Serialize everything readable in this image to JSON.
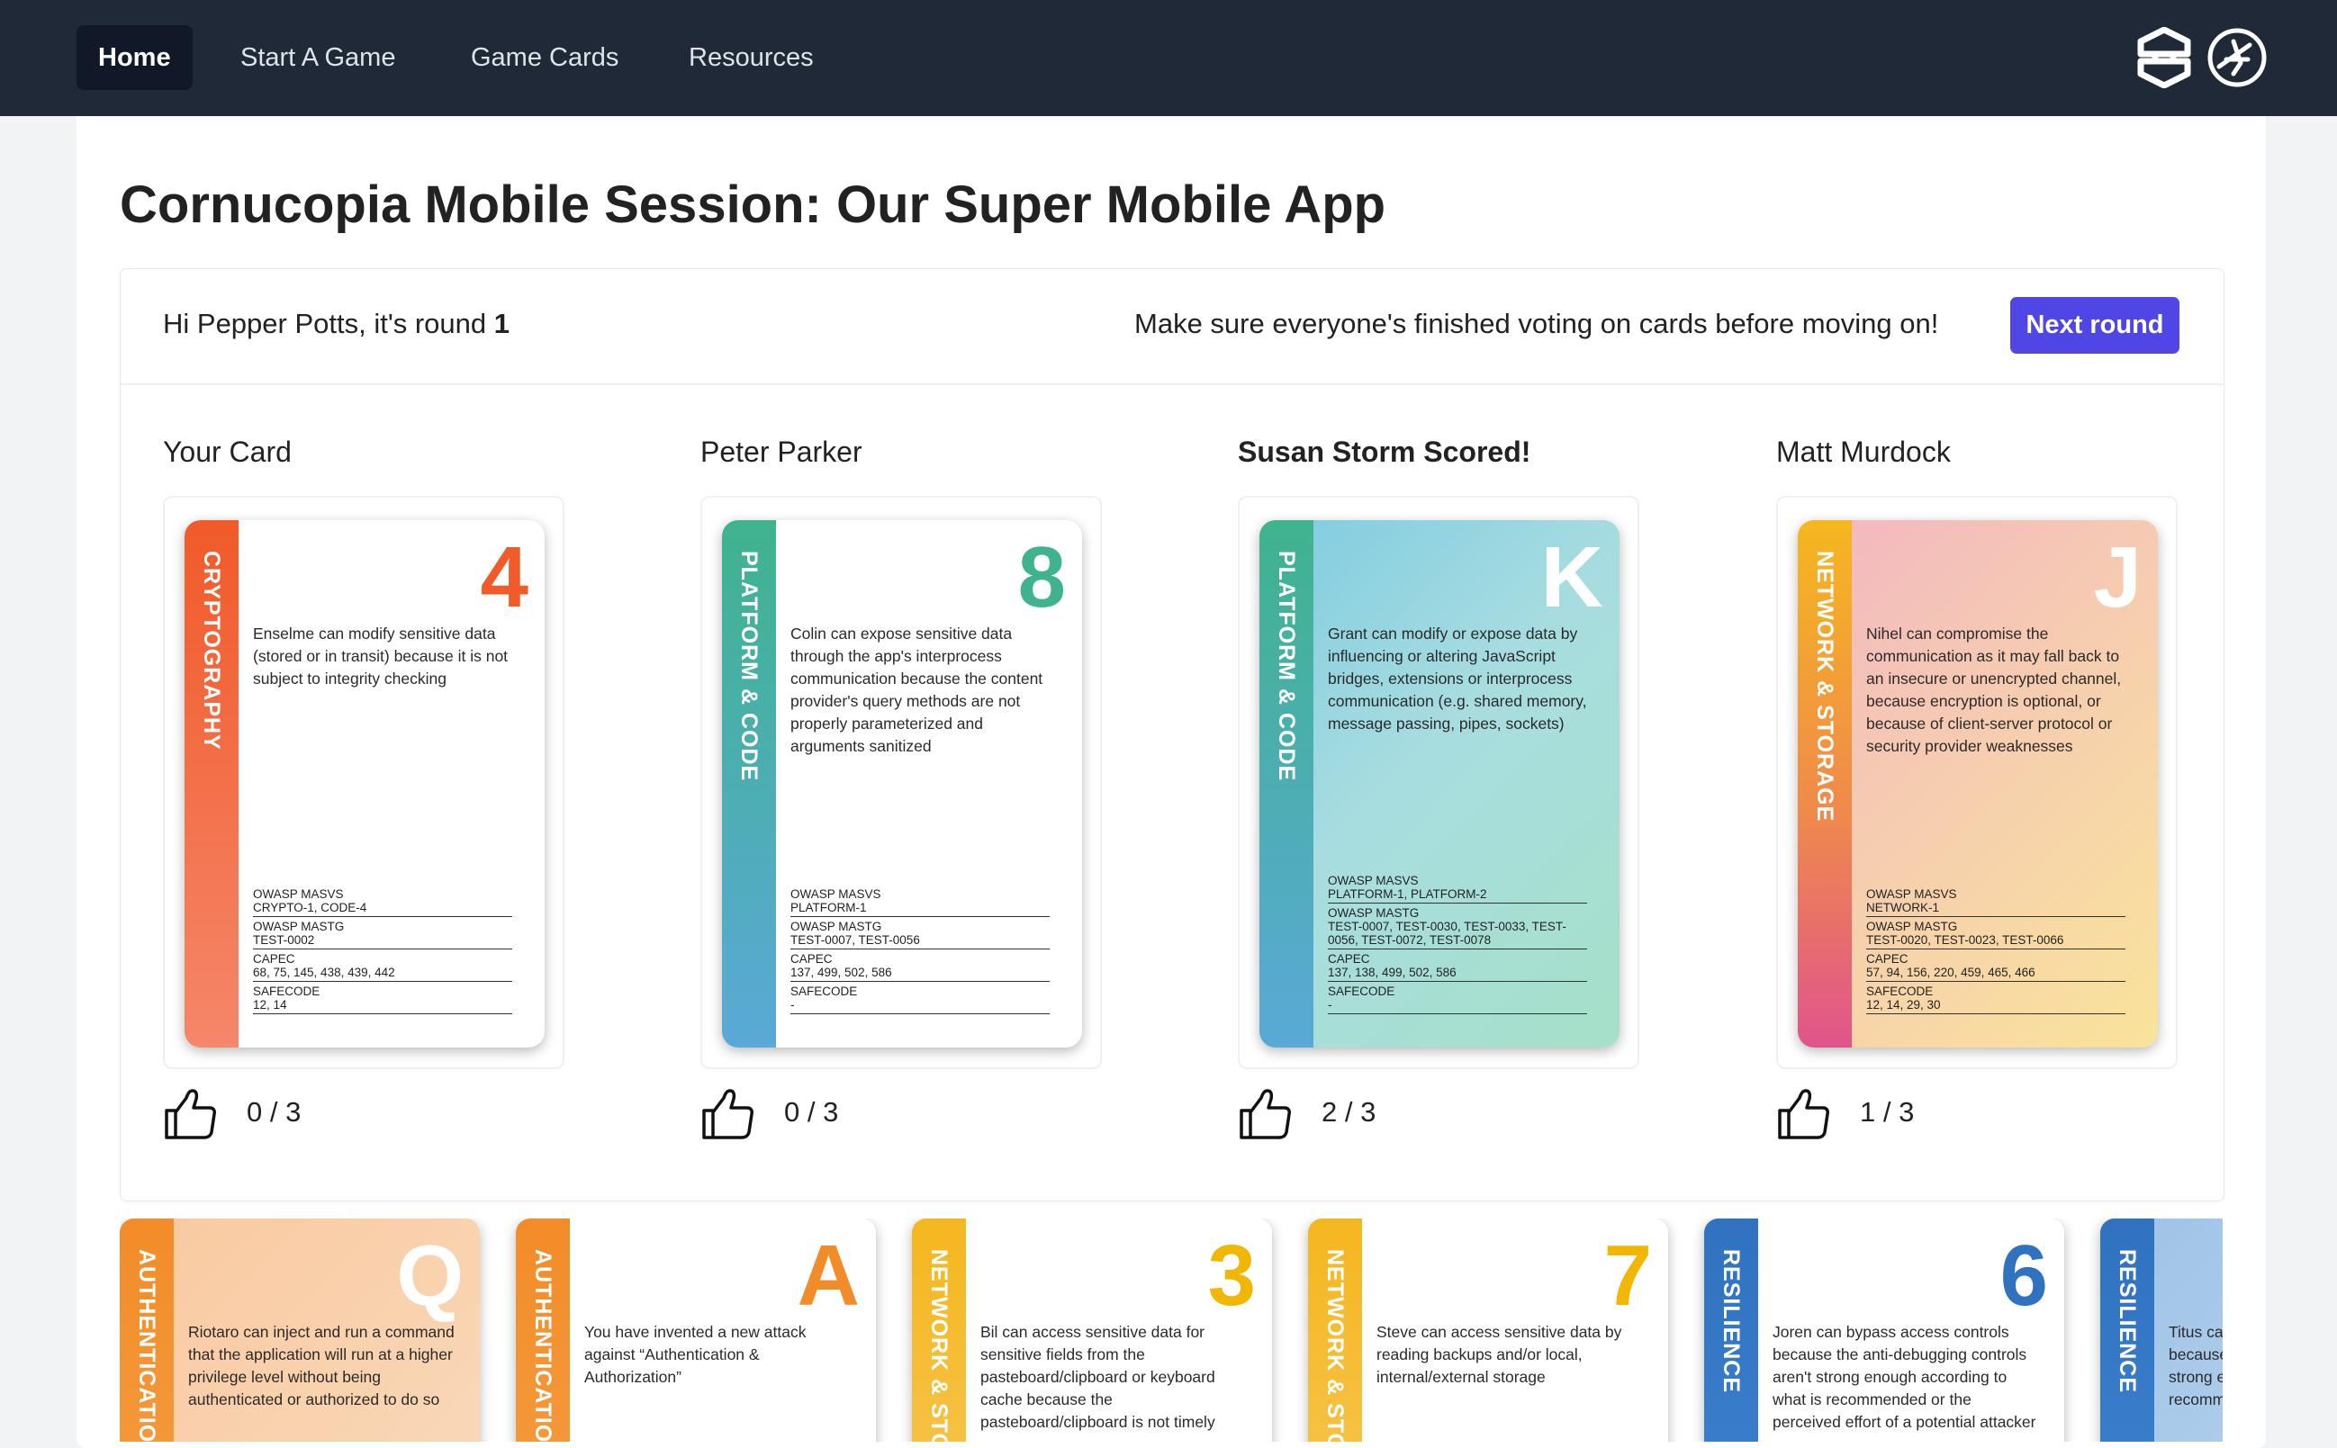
{
  "nav": {
    "items": [
      "Home",
      "Start A Game",
      "Game Cards",
      "Resources"
    ],
    "active": "Home"
  },
  "page_title": "Cornucopia Mobile Session: Our Super Mobile App",
  "session": {
    "greeting_prefix": "Hi Pepper Potts, it's round ",
    "round": "1",
    "hint": "Make sure everyone's finished voting on cards before moving on!",
    "next_button": "Next round"
  },
  "players": [
    {
      "name": "Your Card",
      "scored": false,
      "card": {
        "suit": "CRYPTOGRAPHY",
        "value": "4",
        "theme": "crypto",
        "value_color": "#f15a29",
        "description": "Enselme can modify sensitive data (stored or in transit) because it is not subject to integrity checking",
        "refs": [
          {
            "label": "OWASP MASVS",
            "value": "CRYPTO-1, CODE-4"
          },
          {
            "label": "OWASP MASTG",
            "value": "TEST-0002"
          },
          {
            "label": "CAPEC",
            "value": "68, 75, 145, 438, 439, 442"
          },
          {
            "label": "SAFECODE",
            "value": "12, 14"
          }
        ]
      },
      "votes": "0 / 3"
    },
    {
      "name": "Peter Parker",
      "scored": false,
      "card": {
        "suit": "PLATFORM & CODE",
        "value": "8",
        "theme": "platform",
        "value_color": "#3fb38e",
        "description": "Colin can expose sensitive data through the app's interprocess communication because the content provider's query methods are not properly parameterized and arguments sanitized",
        "refs": [
          {
            "label": "OWASP MASVS",
            "value": "PLATFORM-1"
          },
          {
            "label": "OWASP MASTG",
            "value": "TEST-0007, TEST-0056"
          },
          {
            "label": "CAPEC",
            "value": "137, 499, 502, 586"
          },
          {
            "label": "SAFECODE",
            "value": "-"
          }
        ]
      },
      "votes": "0 / 3"
    },
    {
      "name": "Susan Storm Scored!",
      "scored": true,
      "card": {
        "suit": "PLATFORM & CODE",
        "value": "K",
        "theme": "platform-face",
        "value_color": "#ffffff",
        "description": "Grant can modify or expose data by influencing or altering JavaScript bridges, extensions or interprocess communication (e.g. shared memory, message passing, pipes, sockets)",
        "refs": [
          {
            "label": "OWASP MASVS",
            "value": "PLATFORM-1, PLATFORM-2"
          },
          {
            "label": "OWASP MASTG",
            "value": "TEST-0007, TEST-0030, TEST-0033, TEST-0056, TEST-0072, TEST-0078"
          },
          {
            "label": "CAPEC",
            "value": "137, 138, 499, 502, 586"
          },
          {
            "label": "SAFECODE",
            "value": "-"
          }
        ]
      },
      "votes": "2 / 3"
    },
    {
      "name": "Matt Murdock",
      "scored": false,
      "card": {
        "suit": "NETWORK & STORAGE",
        "value": "J",
        "theme": "network-face",
        "value_color": "#ffffff",
        "description": "Nihel can compromise the communication as it may fall back to an insecure or unencrypted channel, because encryption is optional, or because of client-server protocol or security provider weaknesses",
        "refs": [
          {
            "label": "OWASP MASVS",
            "value": "NETWORK-1"
          },
          {
            "label": "OWASP MASTG",
            "value": "TEST-0020, TEST-0023, TEST-0066"
          },
          {
            "label": "CAPEC",
            "value": "57, 94, 156, 220, 459, 465, 466"
          },
          {
            "label": "SAFECODE",
            "value": "12, 14, 29, 30"
          }
        ]
      },
      "votes": "1 / 3"
    }
  ],
  "hand": [
    {
      "suit": "AUTHENTICATION",
      "value": "Q",
      "theme": "auth-face",
      "value_color": "#ffffff",
      "description": "Riotaro can inject and run a command that the application will run at a higher privilege level without being authenticated or authorized to do so"
    },
    {
      "suit": "AUTHENTICATION",
      "value": "A",
      "theme": "auth",
      "value_color": "#f28c28",
      "description": "You have invented a new attack against “Authentication & Authorization”"
    },
    {
      "suit": "NETWORK & STORAGE",
      "value": "3",
      "theme": "network",
      "value_color": "#f2b705",
      "description": "Bil can access sensitive data for sensitive fields from the pasteboard/clipboard or keyboard cache because the pasteboard/clipboard is not timely"
    },
    {
      "suit": "NETWORK & STORAGE",
      "value": "7",
      "theme": "network",
      "value_color": "#f2b705",
      "description": "Steve can access sensitive data by reading backups and/or local, internal/external storage"
    },
    {
      "suit": "RESILIENCE",
      "value": "6",
      "theme": "resilience",
      "value_color": "#2f72c0",
      "description": "Joren can bypass access controls because the anti-debugging controls aren't strong enough according to what is recommended or the perceived effort of a potential attacker"
    },
    {
      "suit": "RESILIENCE",
      "value": "",
      "theme": "resilience-face",
      "value_color": "#ffffff",
      "description": "Titus can bypass security functions because integrity controls aren't strong enough according to what is recommended or the perceived effort"
    }
  ]
}
